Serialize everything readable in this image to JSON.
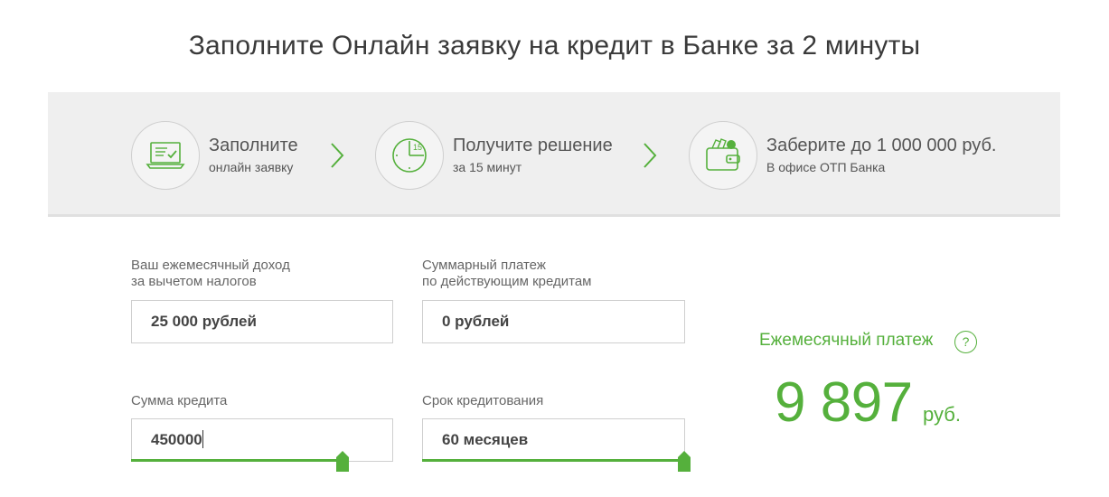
{
  "page": {
    "title": "Заполните Онлайн заявку на кредит в Банке за 2 минуты"
  },
  "steps": [
    {
      "title": "Заполните",
      "subtitle": "онлайн заявку",
      "icon": "laptop-check-icon"
    },
    {
      "title": "Получите решение",
      "subtitle": "за 15 минут",
      "icon": "clock-15-icon"
    },
    {
      "title": "Заберите до 1 000 000 руб.",
      "subtitle": "В офисе ОТП Банка",
      "icon": "wallet-icon"
    }
  ],
  "form": {
    "income": {
      "label_line1": "Ваш ежемесячный доход",
      "label_line2": "за вычетом налогов",
      "value": "25 000 рублей"
    },
    "payments": {
      "label_line1": "Суммарный платеж",
      "label_line2": "по действующим кредитам",
      "value": "0 рублей"
    },
    "amount": {
      "label": "Сумма кредита",
      "value": "450000",
      "slider_level": 0.88
    },
    "term": {
      "label": "Срок кредитования",
      "value": "60 месяцев",
      "slider_level": 1.0
    }
  },
  "result": {
    "label": "Ежемесячный платеж",
    "help": "?",
    "value": "9 897",
    "unit": "руб."
  },
  "colors": {
    "accent": "#55b03c",
    "band": "#efefef"
  }
}
